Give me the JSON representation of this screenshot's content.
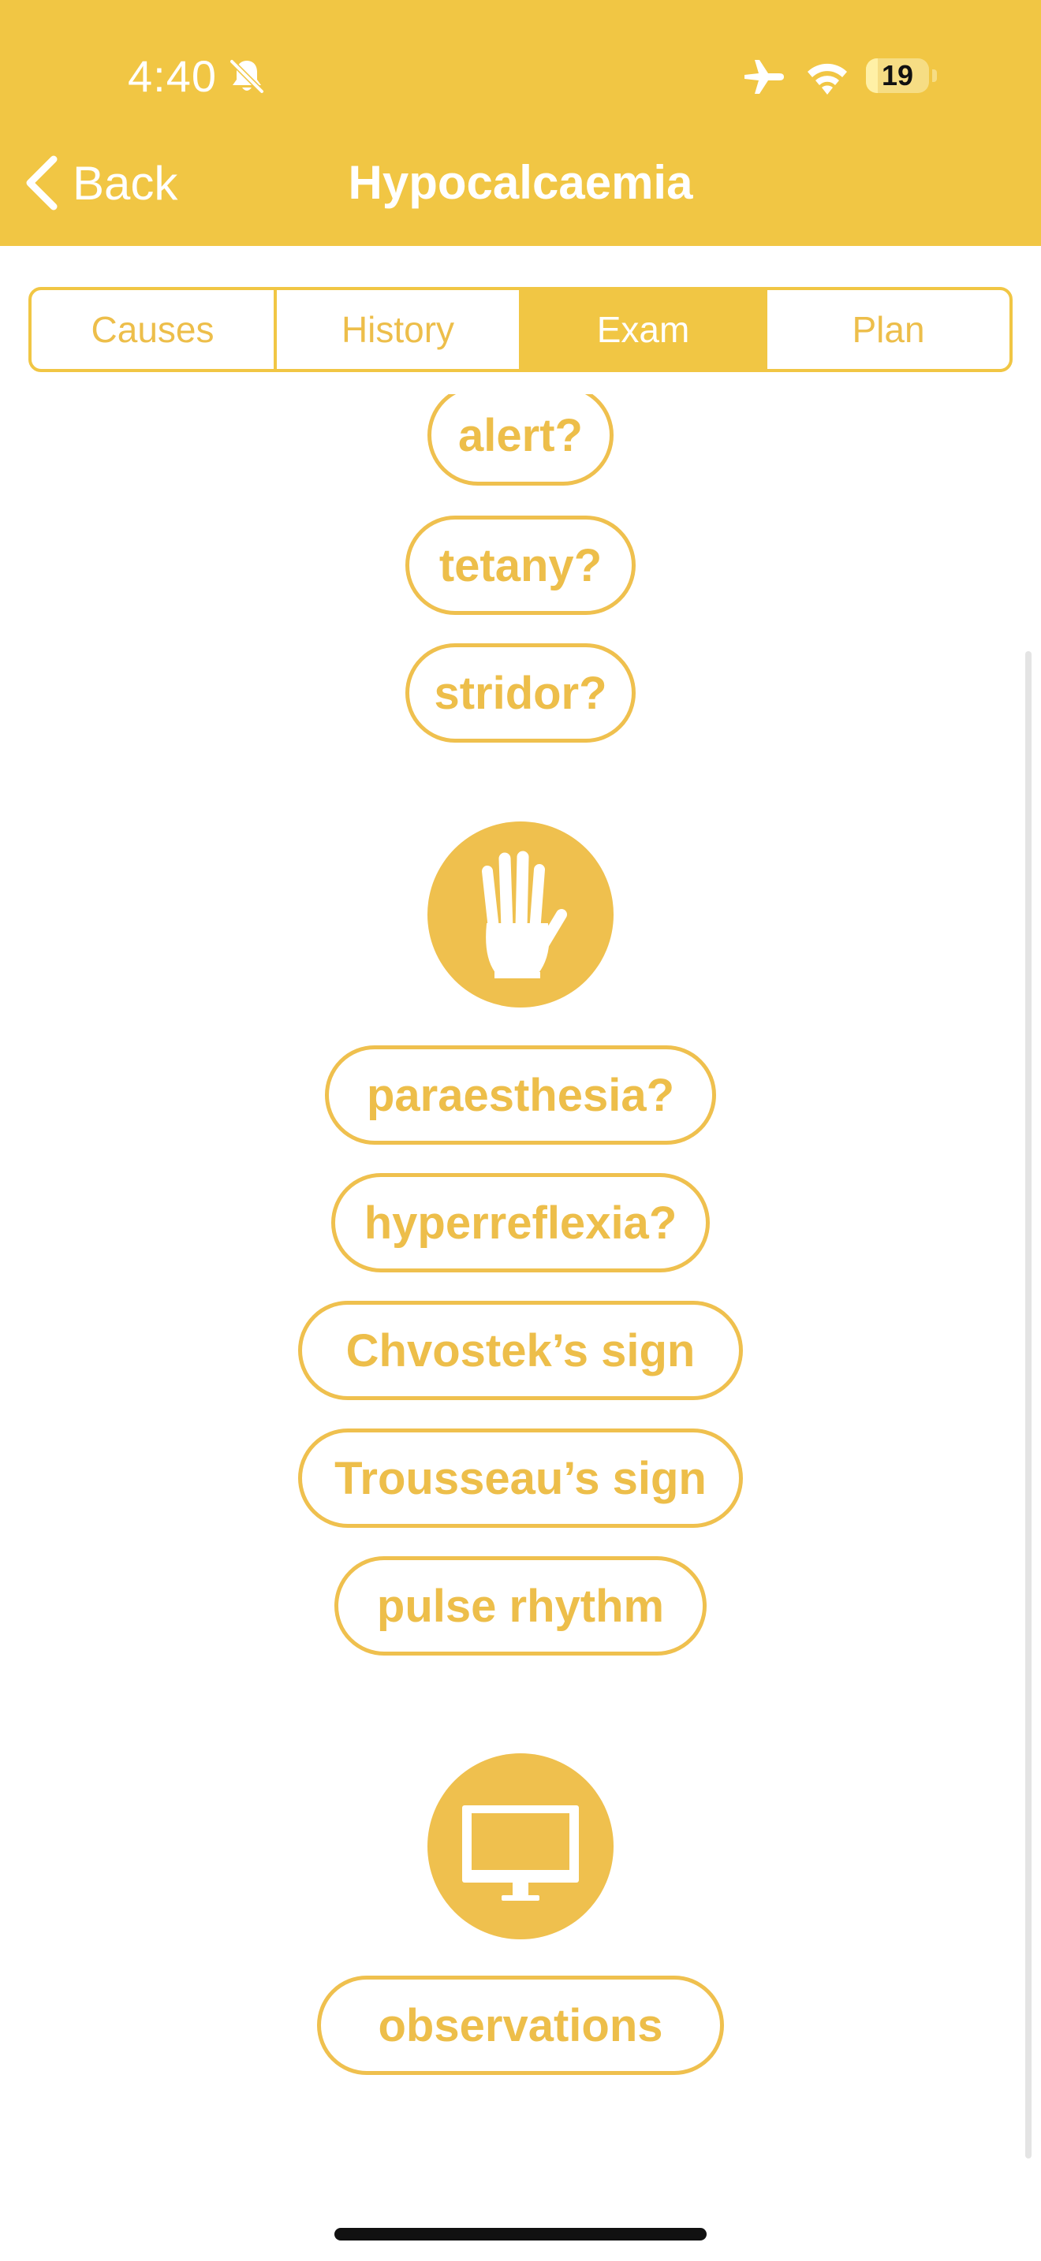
{
  "status_bar": {
    "time": "4:40",
    "battery": "19",
    "battery_level_percent": 19
  },
  "nav": {
    "back_label": "Back",
    "title": "Hypocalcaemia"
  },
  "tabs": [
    {
      "label": "Causes",
      "active": false
    },
    {
      "label": "History",
      "active": false
    },
    {
      "label": "Exam",
      "active": true
    },
    {
      "label": "Plan",
      "active": false
    }
  ],
  "exam": {
    "look_items": [
      "alert?",
      "tetany?",
      "stridor?"
    ],
    "feel_icon": "hand-icon",
    "feel_items": [
      "paraesthesia?",
      "hyperreflexia?",
      "Chvostek’s sign",
      "Trousseau’s sign",
      "pulse rhythm"
    ],
    "monitor_icon": "monitor-icon",
    "monitor_items": [
      "observations"
    ]
  },
  "colors": {
    "accent": "#F1C644",
    "pill_border": "#EFC04E",
    "pill_text": "#EDBE4A",
    "white": "#FFFFFF"
  }
}
